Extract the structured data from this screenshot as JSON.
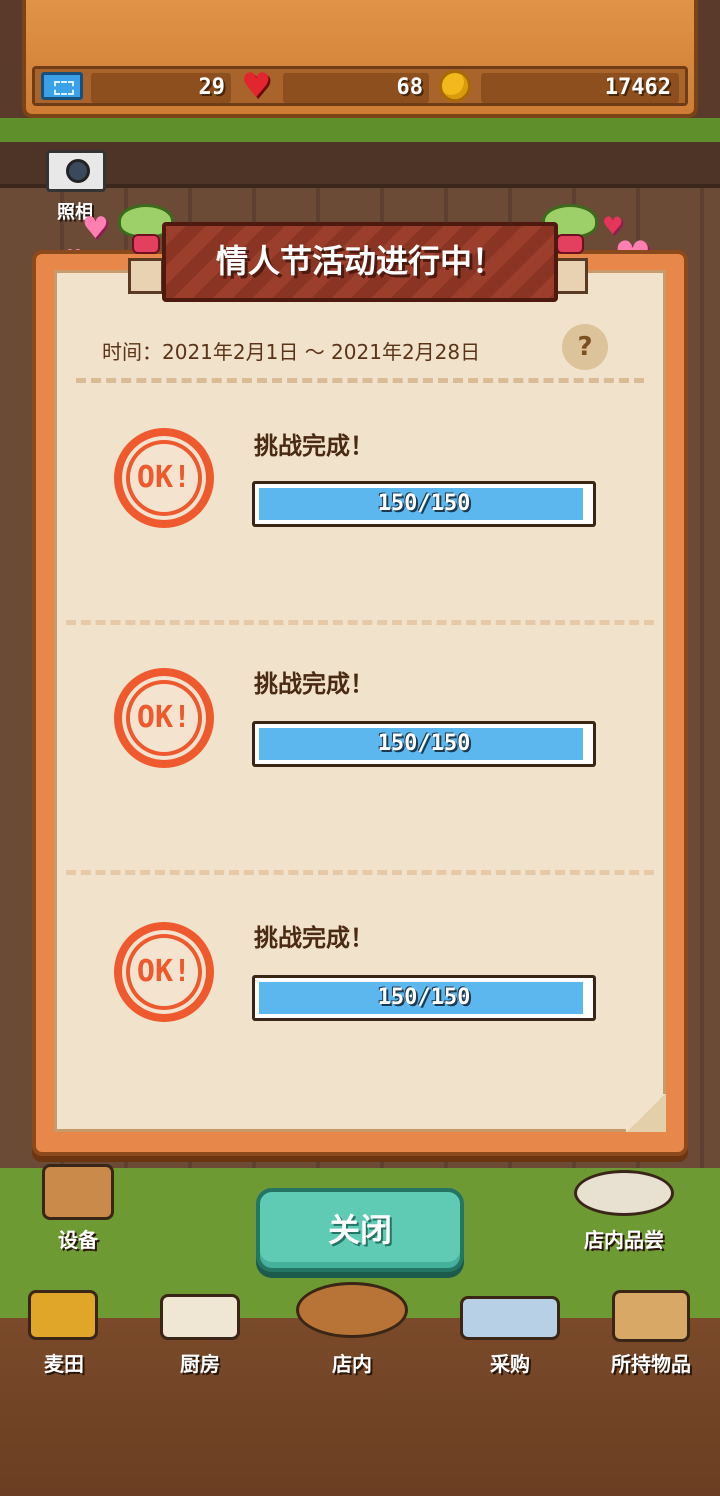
{
  "status_bar": {
    "tickets": "29",
    "hearts": "68",
    "coins": "17462",
    "icons": [
      "ticket-icon",
      "heart-icon",
      "coin-icon"
    ]
  },
  "camera": {
    "label": "照相",
    "icon": "camera-icon"
  },
  "popup": {
    "title": "情人节活动进行中！",
    "date_range": "时间：2021年2月1日 ～ 2021年2月28日",
    "help_label": "?",
    "challenges": [
      {
        "status": "挑战完成！",
        "stamp": "OK!",
        "progress_text": "150/150",
        "progress": 1.0
      },
      {
        "status": "挑战完成！",
        "stamp": "OK!",
        "progress_text": "150/150",
        "progress": 1.0
      },
      {
        "status": "挑战完成！",
        "stamp": "OK!",
        "progress_text": "150/150",
        "progress": 1.0
      }
    ],
    "close_label": "关闭"
  },
  "side_buttons": {
    "equipment": "设备",
    "tasting": "店内品尝"
  },
  "bottom_nav": [
    {
      "label": "麦田",
      "icon": "wheat-icon"
    },
    {
      "label": "厨房",
      "icon": "kitchen-icon"
    },
    {
      "label": "店内",
      "icon": "bread-tray-icon"
    },
    {
      "label": "采购",
      "icon": "shop-goods-icon"
    },
    {
      "label": "所持物品",
      "icon": "box-icon"
    }
  ],
  "colors": {
    "panel_orange": "#e7874a",
    "paper": "#f1e2cc",
    "ok_red": "#ee5a2e",
    "progress_blue": "#5cb7ee",
    "close_teal": "#5fcbb5"
  }
}
